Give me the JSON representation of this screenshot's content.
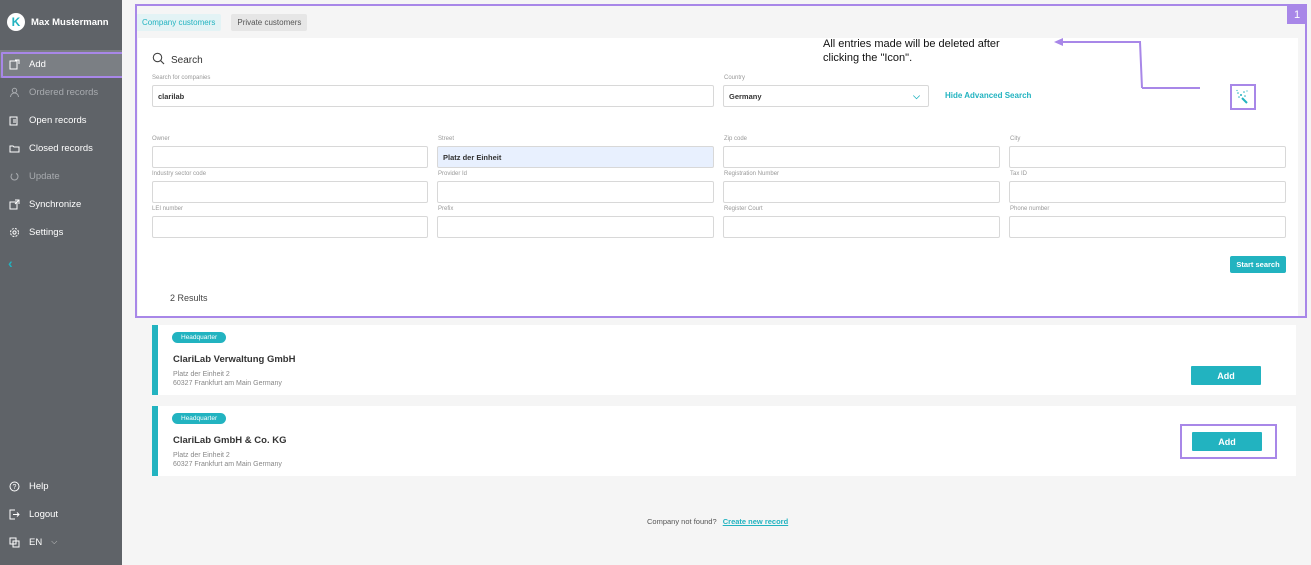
{
  "user": {
    "name": "Max Mustermann",
    "avatar_letter": "K"
  },
  "sidebar": {
    "items": [
      {
        "label": "Add",
        "icon": "add-record-icon",
        "state": "active"
      },
      {
        "label": "Ordered records",
        "icon": "person-icon",
        "state": "disabled"
      },
      {
        "label": "Open records",
        "icon": "open-records-icon",
        "state": "normal"
      },
      {
        "label": "Closed records",
        "icon": "folder-icon",
        "state": "normal"
      },
      {
        "label": "Update",
        "icon": "refresh-icon",
        "state": "disabled"
      },
      {
        "label": "Synchronize",
        "icon": "sync-icon",
        "state": "normal"
      },
      {
        "label": "Settings",
        "icon": "gear-icon",
        "state": "normal"
      }
    ],
    "collapse_icon": "chevron-left-icon",
    "bottom": [
      {
        "label": "Help",
        "icon": "help-icon"
      },
      {
        "label": "Logout",
        "icon": "logout-icon"
      },
      {
        "label": "EN",
        "icon": "language-icon"
      }
    ]
  },
  "tabs": [
    {
      "label": "Company customers",
      "active": true
    },
    {
      "label": "Private customers",
      "active": false
    }
  ],
  "search": {
    "title": "Search",
    "company_label": "Search for companies",
    "company_value": "clarilab",
    "country_label": "Country",
    "country_value": "Germany",
    "hide_advanced": "Hide Advanced Search",
    "start_search": "Start search",
    "results_count": "2 Results"
  },
  "advanced": [
    {
      "label": "Owner",
      "value": ""
    },
    {
      "label": "Street",
      "value": "Platz der Einheit"
    },
    {
      "label": "Zip code",
      "value": ""
    },
    {
      "label": "City",
      "value": ""
    },
    {
      "label": "Industry sector code",
      "value": ""
    },
    {
      "label": "Provider Id",
      "value": ""
    },
    {
      "label": "Registration Number",
      "value": ""
    },
    {
      "label": "Tax ID",
      "value": ""
    },
    {
      "label": "LEI number",
      "value": ""
    },
    {
      "label": "Prefix",
      "value": ""
    },
    {
      "label": "Register Court",
      "value": ""
    },
    {
      "label": "Phone number",
      "value": ""
    }
  ],
  "annotation": {
    "number": "1",
    "note_line1": "All entries made will be deleted after",
    "note_line2": "clicking the \"Icon\"."
  },
  "results": [
    {
      "badge": "Headquarter",
      "name": "ClariLab Verwaltung GmbH",
      "street": "Platz der Einheit 2",
      "city": "60327 Frankfurt am Main Germany",
      "button": "Add"
    },
    {
      "badge": "Headquarter",
      "name": "ClariLab GmbH & Co. KG",
      "street": "Platz der Einheit 2",
      "city": "60327 Frankfurt am Main Germany",
      "button": "Add"
    }
  ],
  "footer": {
    "text": "Company not found?",
    "link": "Create new record"
  },
  "colors": {
    "accent": "#22b3c0",
    "sidebar": "#5f6368",
    "annotation": "#a887e8"
  }
}
